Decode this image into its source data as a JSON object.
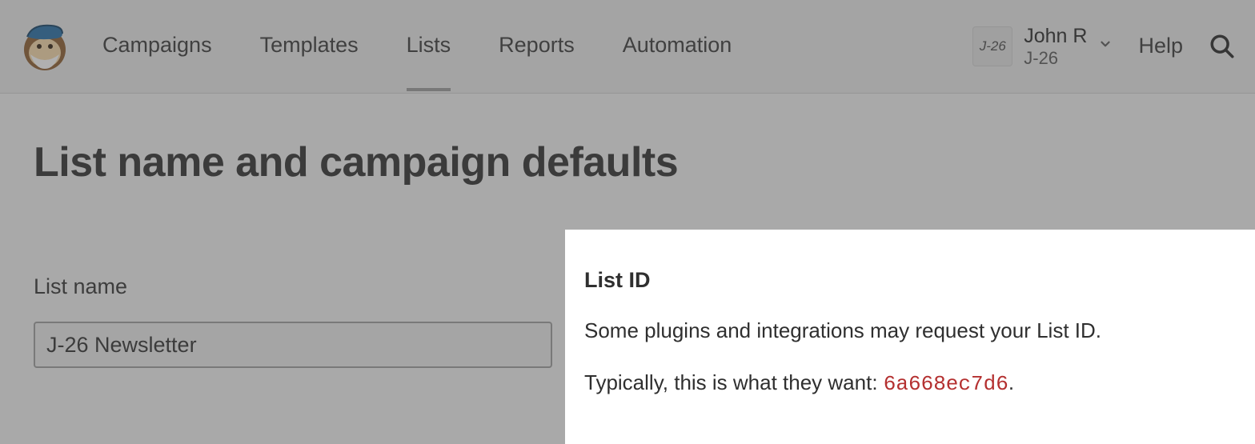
{
  "nav": {
    "items": [
      {
        "label": "Campaigns"
      },
      {
        "label": "Templates"
      },
      {
        "label": "Lists"
      },
      {
        "label": "Reports"
      },
      {
        "label": "Automation"
      }
    ],
    "help": "Help"
  },
  "account": {
    "avatar_text": "J-26",
    "name": "John R",
    "sub": "J-26"
  },
  "page": {
    "title": "List name and campaign defaults"
  },
  "form": {
    "list_name_label": "List name",
    "list_name_value": "J-26 Newsletter"
  },
  "listid": {
    "heading": "List ID",
    "description": "Some plugins and integrations may request your List ID.",
    "prefix": "Typically, this is what they want: ",
    "code": "6a668ec7d6",
    "suffix": "."
  }
}
